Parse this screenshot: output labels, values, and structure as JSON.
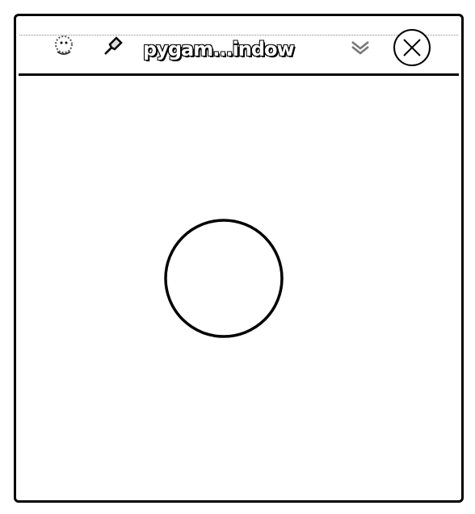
{
  "window": {
    "title": "pygam...indow",
    "icons": [
      "app-icon",
      "pin-icon",
      "chevron-down-icon",
      "close-icon"
    ]
  },
  "canvas": {
    "shape": "circle",
    "stroke_color": "#000000",
    "fill_color": "#ffffff"
  }
}
